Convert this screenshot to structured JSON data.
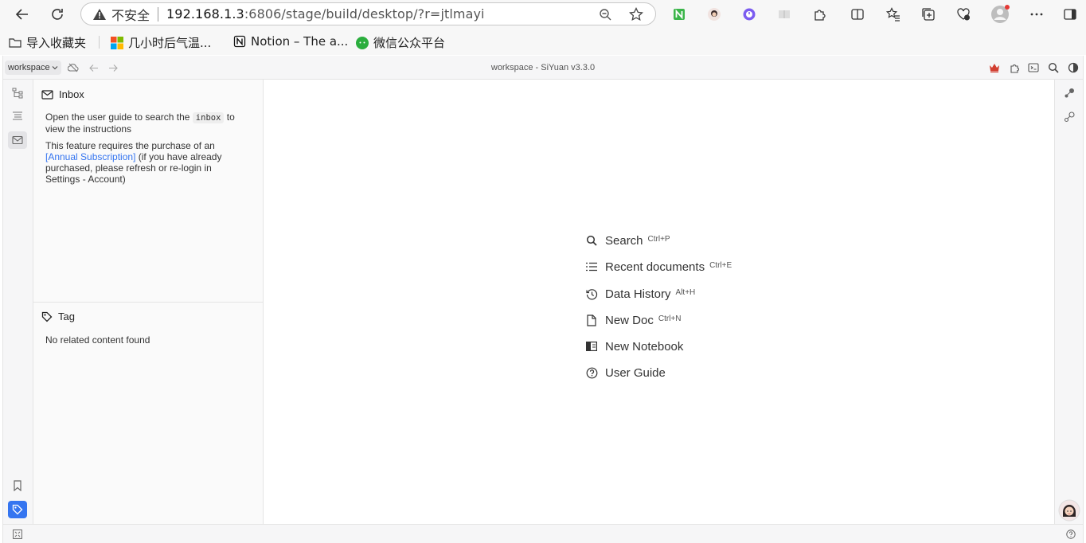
{
  "browser": {
    "security_label": "不安全",
    "url_host": "192.168.1.3",
    "url_rest": ":6806/stage/build/desktop/?r=jtlmayi",
    "bookmarks": [
      "导入收藏夹",
      "几小时后气温...",
      "Notion – The a...",
      "微信公众平台"
    ]
  },
  "app": {
    "workspace_label": "workspace",
    "title": "workspace - SiYuan v3.3.0"
  },
  "inbox": {
    "title": "Inbox",
    "guide_before": "Open the user guide to search the",
    "guide_code": "inbox",
    "guide_after": "to",
    "guide_line2": "view the instructions",
    "sub_line1": "This feature requires the purchase of an",
    "sub_link": "[Annual Subscription]",
    "sub_after_link": "(if you have already",
    "sub_line3": "purchased, please refresh or re-login in",
    "sub_line4": "Settings - Account)"
  },
  "tag": {
    "title": "Tag",
    "empty": "No related content found"
  },
  "editor_menu": [
    {
      "label": "Search",
      "hotkey": "Ctrl+P",
      "icon": "search-icon"
    },
    {
      "label": "Recent documents",
      "hotkey": "Ctrl+E",
      "icon": "list-icon"
    },
    {
      "label": "Data History",
      "hotkey": "Alt+H",
      "icon": "history-icon"
    },
    {
      "label": "New Doc",
      "hotkey": "Ctrl+N",
      "icon": "file-icon"
    },
    {
      "label": "New Notebook",
      "hotkey": "",
      "icon": "notebook-icon"
    },
    {
      "label": "User Guide",
      "hotkey": "",
      "icon": "help-icon"
    }
  ],
  "colors": {
    "accent": "#3575f0",
    "crown": "#d23f31"
  }
}
